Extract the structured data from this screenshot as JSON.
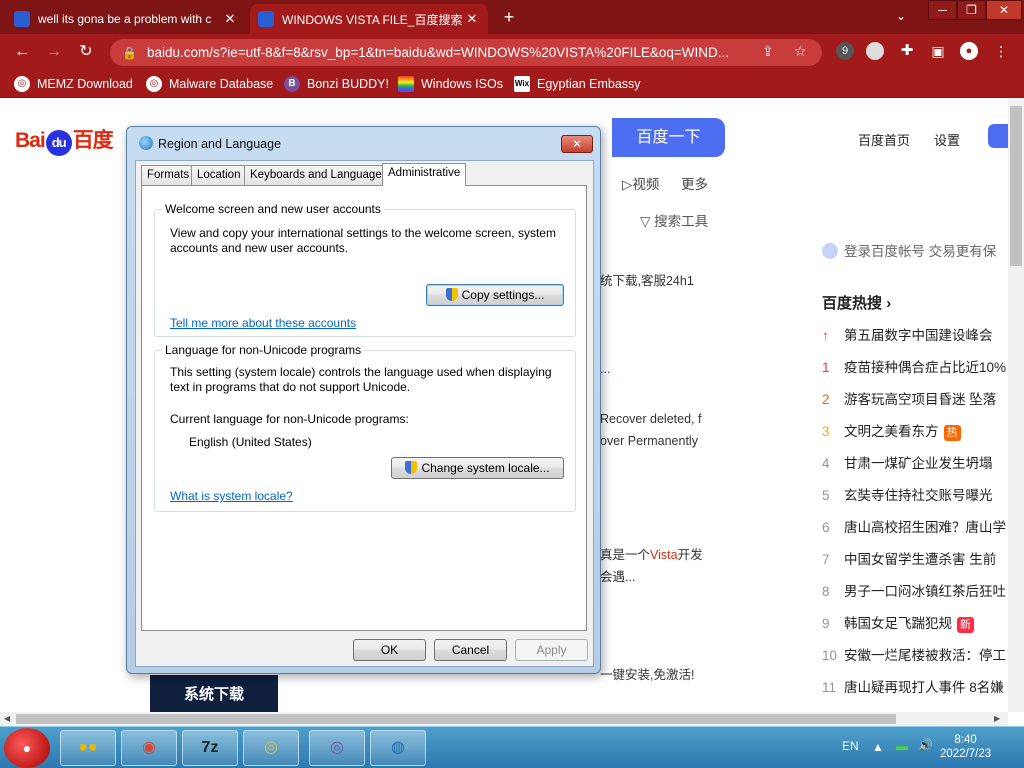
{
  "browser": {
    "tabs": [
      {
        "title": "well its gona be a problem with c"
      },
      {
        "title": "WINDOWS VISTA FILE_百度搜索"
      }
    ],
    "new_tab": "+",
    "url": "baidu.com/s?ie=utf-8&f=8&rsv_bp=1&tn=baidu&wd=WINDOWS%20VISTA%20FILE&oq=WIND...",
    "ext_badge": "9",
    "bookmarks": [
      {
        "label": "MEMZ Download"
      },
      {
        "label": "Malware Database"
      },
      {
        "label": "Bonzi BUDDY!"
      },
      {
        "label": "Windows ISOs"
      },
      {
        "label": "Egyptian Embassy"
      }
    ]
  },
  "baidu": {
    "logo_left": "Bai",
    "logo_du": "du",
    "logo_right": "百度",
    "search_button": "百度一下",
    "top_links": [
      "百度首页",
      "设置"
    ],
    "nav": [
      "视频",
      "更多"
    ],
    "tools": "搜索工具",
    "results_fragments": [
      "统下载,客服24h1",
      "...",
      "Recover deleted, f",
      "over Permanently",
      "真是一个",
      "Vista",
      "开发",
      "会遇...",
      "一键安装,免激活!"
    ],
    "login_tip": "登录百度帐号 交易更有保",
    "hot_title": "百度热搜",
    "hot_list": [
      {
        "num": "",
        "text": "第五届数字中国建设峰会",
        "tag": ""
      },
      {
        "num": "1",
        "text": "疫苗接种偶合症占比近10%",
        "tag": ""
      },
      {
        "num": "2",
        "text": "游客玩高空项目昏迷 坠落",
        "tag": ""
      },
      {
        "num": "3",
        "text": "文明之美看东方",
        "tag": "热"
      },
      {
        "num": "4",
        "text": "甘肃一煤矿企业发生坍塌",
        "tag": ""
      },
      {
        "num": "5",
        "text": "玄奘寺住持社交账号曝光",
        "tag": ""
      },
      {
        "num": "6",
        "text": "唐山高校招生困难？唐山学",
        "tag": ""
      },
      {
        "num": "7",
        "text": "中国女留学生遭杀害 生前",
        "tag": ""
      },
      {
        "num": "8",
        "text": "男子一口闷冰镇红茶后狂吐",
        "tag": ""
      },
      {
        "num": "9",
        "text": "韩国女足飞踹犯规",
        "tag": "新"
      },
      {
        "num": "10",
        "text": "安徽一烂尾楼被救活：停工",
        "tag": ""
      },
      {
        "num": "11",
        "text": "唐山疑再现打人事件 8名嫌",
        "tag": ""
      }
    ],
    "banner": "系统下载"
  },
  "dialog": {
    "title": "Region and Language",
    "tabs": [
      "Formats",
      "Location",
      "Keyboards and Languages",
      "Administrative"
    ],
    "group1": {
      "label": "Welcome screen and new user accounts",
      "text1": "View and copy your international settings to the welcome screen, system",
      "text2": "accounts and new user accounts.",
      "button": "Copy settings...",
      "link": "Tell me more about these accounts"
    },
    "group2": {
      "label": "Language for non-Unicode programs",
      "text1": "This setting (system locale) controls the language used when displaying",
      "text2": "text in programs that do not support Unicode.",
      "current_label": "Current language for non-Unicode programs:",
      "current_value": "English (United States)",
      "button": "Change system locale...",
      "link": "What is system locale?"
    },
    "buttons": {
      "ok": "OK",
      "cancel": "Cancel",
      "apply": "Apply"
    }
  },
  "taskbar": {
    "items": [
      "",
      "",
      "7z",
      "",
      "",
      ""
    ],
    "lang": "EN",
    "time": "8:40",
    "date": "2022/7/23"
  }
}
